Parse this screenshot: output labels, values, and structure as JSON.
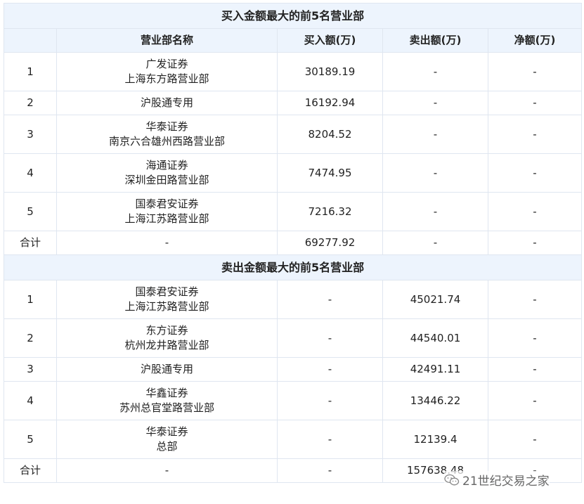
{
  "buy_section": {
    "title": "买入金额最大的前5名营业部",
    "headers": [
      "营业部名称",
      "买入额(万)",
      "卖出额(万)",
      "净额(万)"
    ],
    "rows": [
      {
        "rank": "1",
        "name1": "广发证券",
        "name2": "上海东方路营业部",
        "buy": "30189.19",
        "sell": "-",
        "net": "-"
      },
      {
        "rank": "2",
        "name1": "沪股通专用",
        "name2": "",
        "buy": "16192.94",
        "sell": "-",
        "net": "-"
      },
      {
        "rank": "3",
        "name1": "华泰证券",
        "name2": "南京六合雄州西路营业部",
        "buy": "8204.52",
        "sell": "-",
        "net": "-"
      },
      {
        "rank": "4",
        "name1": "海通证券",
        "name2": "深圳金田路营业部",
        "buy": "7474.95",
        "sell": "-",
        "net": "-"
      },
      {
        "rank": "5",
        "name1": "国泰君安证券",
        "name2": "上海江苏路营业部",
        "buy": "7216.32",
        "sell": "-",
        "net": "-"
      }
    ],
    "total": {
      "label": "合计",
      "name": "-",
      "buy": "69277.92",
      "sell": "-",
      "net": "-"
    }
  },
  "sell_section": {
    "title": "卖出金额最大的前5名营业部",
    "rows": [
      {
        "rank": "1",
        "name1": "国泰君安证券",
        "name2": "上海江苏路营业部",
        "buy": "-",
        "sell": "45021.74",
        "net": "-"
      },
      {
        "rank": "2",
        "name1": "东方证券",
        "name2": "杭州龙井路营业部",
        "buy": "-",
        "sell": "44540.01",
        "net": "-"
      },
      {
        "rank": "3",
        "name1": "沪股通专用",
        "name2": "",
        "buy": "-",
        "sell": "42491.11",
        "net": "-"
      },
      {
        "rank": "4",
        "name1": "华鑫证券",
        "name2": "苏州总官堂路营业部",
        "buy": "-",
        "sell": "13446.22",
        "net": "-"
      },
      {
        "rank": "5",
        "name1": "华泰证券",
        "name2": "总部",
        "buy": "-",
        "sell": "12139.4",
        "net": "-"
      }
    ],
    "total": {
      "label": "合计",
      "name": "-",
      "buy": "-",
      "sell": "157638.48",
      "net": "-"
    }
  },
  "watermark": {
    "text": "21世纪交易之家",
    "icon": "wechat-icon"
  }
}
